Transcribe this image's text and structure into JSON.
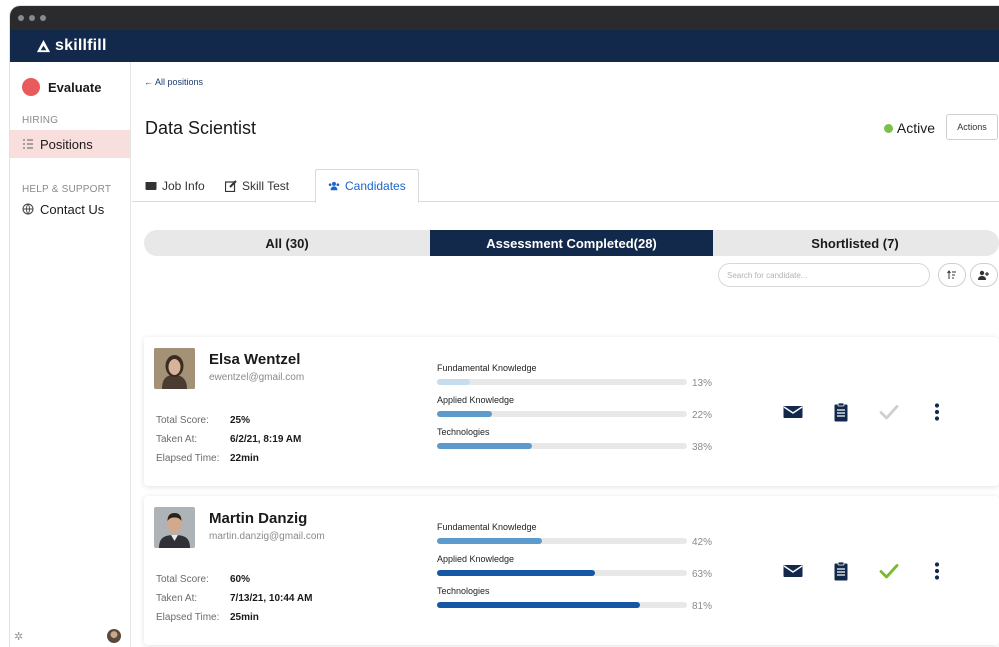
{
  "app": {
    "name": "skillfill",
    "evaluate_label": "Evaluate"
  },
  "sidebar": {
    "hiring_label": "HIRING",
    "positions_label": "Positions",
    "help_label": "HELP & SUPPORT",
    "contact_label": "Contact Us"
  },
  "header": {
    "back_link": "← All positions",
    "title": "Data Scientist",
    "status": "Active",
    "actions_label": "Actions"
  },
  "tabs": [
    {
      "label": "Job Info"
    },
    {
      "label": "Skill Test"
    },
    {
      "label": "Candidates"
    }
  ],
  "filters": [
    {
      "label": "All (30)"
    },
    {
      "label": "Assessment Completed(28)"
    },
    {
      "label": "Shortlisted (7)"
    }
  ],
  "search": {
    "placeholder": "Search for candidate..."
  },
  "stat_labels": {
    "total": "Total Score:",
    "taken": "Taken At:",
    "elapsed": "Elapsed Time:"
  },
  "candidates": [
    {
      "name": "Elsa Wentzel",
      "email": "ewentzel@gmail.com",
      "total_score": "25%",
      "taken_at": "6/2/21, 8:19 AM",
      "elapsed": "22min",
      "shortlisted": false,
      "skills": [
        {
          "label": "Fundamental Knowledge",
          "pct": "13%",
          "value": 0.13,
          "color": "#c5ddef"
        },
        {
          "label": "Applied Knowledge",
          "pct": "22%",
          "value": 0.22,
          "color": "#5d9bcc"
        },
        {
          "label": "Technologies",
          "pct": "38%",
          "value": 0.38,
          "color": "#5d9bcc"
        }
      ]
    },
    {
      "name": "Martin Danzig",
      "email": "martin.danzig@gmail.com",
      "total_score": "60%",
      "taken_at": "7/13/21, 10:44 AM",
      "elapsed": "25min",
      "shortlisted": true,
      "skills": [
        {
          "label": "Fundamental Knowledge",
          "pct": "42%",
          "value": 0.42,
          "color": "#5d9bcc"
        },
        {
          "label": "Applied Knowledge",
          "pct": "63%",
          "value": 0.63,
          "color": "#1557a4"
        },
        {
          "label": "Technologies",
          "pct": "81%",
          "value": 0.81,
          "color": "#1557a4"
        }
      ]
    }
  ],
  "colors": {
    "navy": "#13294b",
    "active_green": "#7cc04b",
    "evaluate_red": "#e85a5c",
    "check_green": "#7cb82f",
    "check_grey": "#cfcfcf"
  },
  "icons": [
    "mail-icon",
    "clipboard-icon",
    "check-icon",
    "more-vertical-icon"
  ]
}
